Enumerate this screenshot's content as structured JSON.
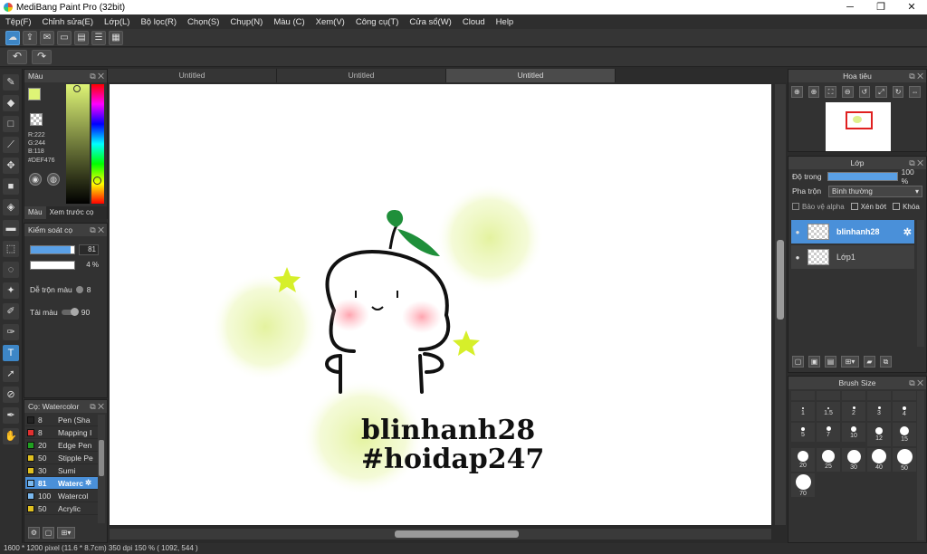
{
  "window": {
    "title": "MediBang Paint Pro (32bit)",
    "minimize": "─",
    "restore": "❐",
    "close": "✕"
  },
  "menu": [
    "Tệp(F)",
    "Chỉnh sửa(E)",
    "Lớp(L)",
    "Bộ lọc(R)",
    "Chọn(S)",
    "Chụp(N)",
    "Màu (C)",
    "Xem(V)",
    "Công cụ(T)",
    "Cửa sổ(W)",
    "Cloud",
    "Help"
  ],
  "doc_tabs": [
    "Untitled",
    "Untitled",
    "Untitled"
  ],
  "color_panel": {
    "title": "Màu",
    "rgb": {
      "r": "R:222",
      "g": "G:244",
      "b": "B:118"
    },
    "hex": "#DEF476",
    "primary_color": "#DEF476",
    "tab_color": "Màu",
    "tab_preview": "Xem trước cọ"
  },
  "brush_control": {
    "title": "Kiểm soát cọ",
    "size": "81",
    "opacity": "4 %",
    "mix_label": "Dễ trộn màu",
    "mix_value": "8",
    "refill_label": "Tải màu",
    "refill_value": "90"
  },
  "brush_list": {
    "title": "Cọ: Watercolor",
    "items": [
      {
        "size": "8",
        "name": "Pen (Sha",
        "color": "#222222"
      },
      {
        "size": "8",
        "name": "Mapping I",
        "color": "#e03030"
      },
      {
        "size": "20",
        "name": "Edge Pen",
        "color": "#20a020"
      },
      {
        "size": "50",
        "name": "Stipple Pe",
        "color": "#e0c020"
      },
      {
        "size": "30",
        "name": "Sumi",
        "color": "#e0c020"
      },
      {
        "size": "81",
        "name": "Waterc",
        "color": "#7ab8ee",
        "selected": true
      },
      {
        "size": "100",
        "name": "Watercol",
        "color": "#7ab8ee"
      },
      {
        "size": "50",
        "name": "Acrylic",
        "color": "#e0c020"
      }
    ]
  },
  "navigator": {
    "title": "Hoa tiêu"
  },
  "layers": {
    "title": "Lớp",
    "opacity_label": "Độ trong",
    "opacity_value": "100 %",
    "blend_label": "Pha trộn",
    "blend_value": "Bình thường",
    "protect_alpha": "Bảo vệ alpha",
    "clipping": "Xén bớt",
    "lock": "Khóa",
    "items": [
      {
        "name": "blinhanh28",
        "selected": true
      },
      {
        "name": "Lớp1",
        "selected": false
      }
    ]
  },
  "brush_size": {
    "title": "Brush Size",
    "sizes": [
      "1",
      "1.5",
      "2",
      "3",
      "4",
      "5",
      "7",
      "10",
      "12",
      "15",
      "20",
      "25",
      "30",
      "40",
      "50",
      "70"
    ]
  },
  "canvas_text": {
    "line1": "blinhanh28",
    "line2": "#hoidap247"
  },
  "status": "1600 * 1200 pixel  (11.6 * 8.7cm)  350 dpi  150 %  ( 1092, 544 )"
}
